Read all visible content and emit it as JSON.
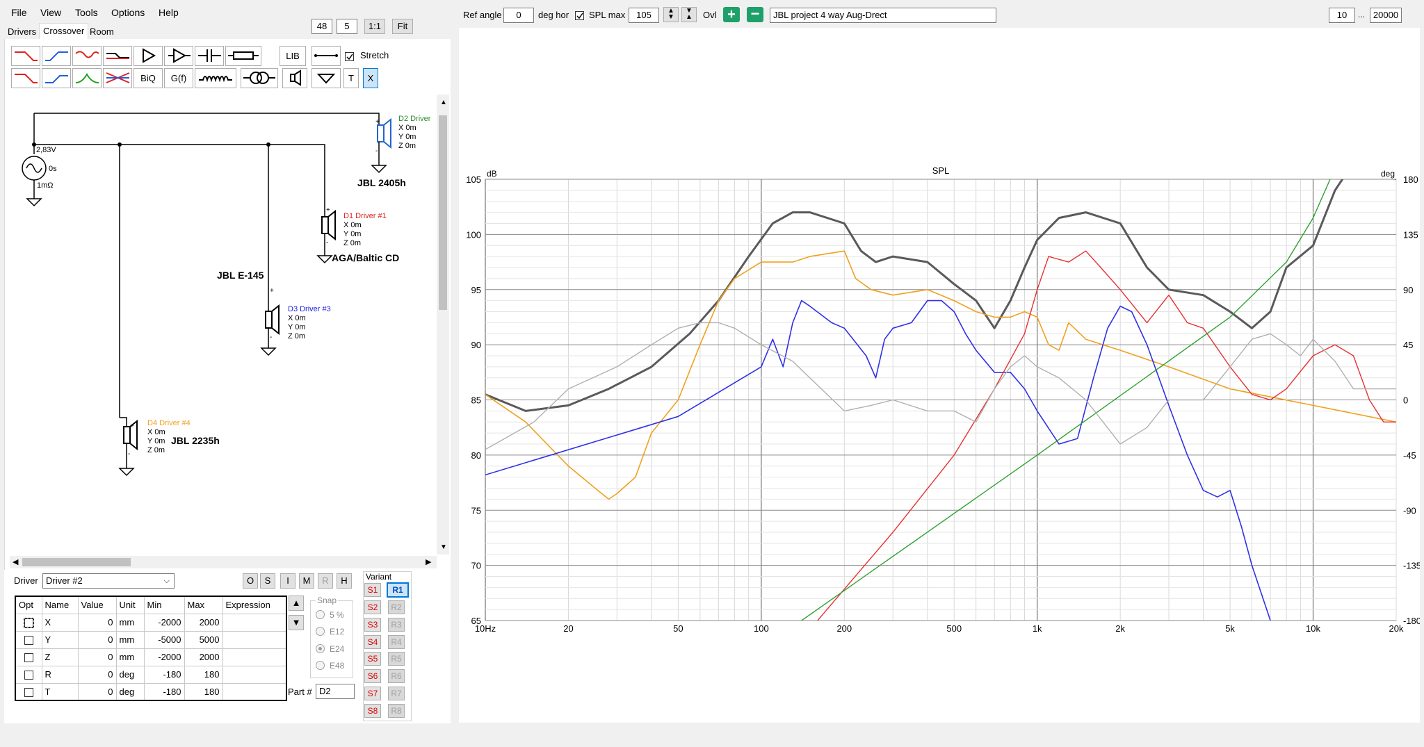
{
  "menu": [
    "File",
    "View",
    "Tools",
    "Options",
    "Help"
  ],
  "top_controls": {
    "value1": "48",
    "value2": "5",
    "ratio_button": "1:1",
    "fit_button": "Fit"
  },
  "tabs": [
    "Drivers",
    "Crossover",
    "Room"
  ],
  "toolbar": {
    "lib": "LIB",
    "biq": "BiQ",
    "gf": "G(f)",
    "t": "T",
    "x": "X",
    "stretch": "Stretch"
  },
  "schematic": {
    "source": {
      "voltage": "2,83V",
      "delay": "0s",
      "impedance": "1mΩ"
    },
    "drivers": [
      {
        "id": "D2",
        "label": "D2 Driver",
        "x": "X 0m",
        "y": "Y 0m",
        "z": "Z 0m",
        "name": "JBL 2405h",
        "color": "#2e8b2e"
      },
      {
        "id": "D1",
        "label": "D1 Driver #1",
        "x": "X 0m",
        "y": "Y 0m",
        "z": "Z 0m",
        "name": "AGA/Baltic CD",
        "color": "#e02020"
      },
      {
        "id": "D3",
        "label": "D3 Driver #3",
        "x": "X 0m",
        "y": "Y 0m",
        "z": "Z 0m",
        "name": "JBL E-145",
        "color": "#2020e0"
      },
      {
        "id": "D4",
        "label": "D4 Driver #4",
        "x": "X 0m",
        "y": "Y 0m",
        "z": "Z 0m",
        "name": "JBL 2235h",
        "color": "#f0a020"
      }
    ]
  },
  "driver_panel": {
    "label": "Driver",
    "selected": "Driver #2",
    "buttons": [
      "O",
      "S",
      "I",
      "M",
      "R",
      "H"
    ],
    "columns": [
      "Opt",
      "Name",
      "Value",
      "Unit",
      "Min",
      "Max",
      "Expression"
    ],
    "rows": [
      {
        "name": "X",
        "value": "0",
        "unit": "mm",
        "min": "-2000",
        "max": "2000",
        "expr": ""
      },
      {
        "name": "Y",
        "value": "0",
        "unit": "mm",
        "min": "-5000",
        "max": "5000",
        "expr": ""
      },
      {
        "name": "Z",
        "value": "0",
        "unit": "mm",
        "min": "-2000",
        "max": "2000",
        "expr": ""
      },
      {
        "name": "R",
        "value": "0",
        "unit": "deg",
        "min": "-180",
        "max": "180",
        "expr": ""
      },
      {
        "name": "T",
        "value": "0",
        "unit": "deg",
        "min": "-180",
        "max": "180",
        "expr": ""
      }
    ],
    "snap": {
      "label": "Snap",
      "options": [
        "5 %",
        "E12",
        "E24",
        "E48"
      ],
      "selected": "E24"
    },
    "part_label": "Part #",
    "part_value": "D2",
    "variant_label": "Variant",
    "variants_s": [
      "S1",
      "S2",
      "S3",
      "S4",
      "S5",
      "S6",
      "S7",
      "S8"
    ],
    "variants_r": [
      "R1",
      "R2",
      "R3",
      "R4",
      "R5",
      "R6",
      "R7",
      "R8"
    ]
  },
  "graph_controls": {
    "ref_angle_label": "Ref angle",
    "ref_angle": "0",
    "deg_hor": "deg hor",
    "spl_max_label": "SPL max",
    "spl_max": "105",
    "ovl": "Ovl",
    "title": "JBL project 4 way Aug-Drect",
    "fmin": "10",
    "dots": "...",
    "fmax": "20000"
  },
  "chart_data": {
    "type": "line",
    "title": "SPL",
    "ylabel": "dB",
    "y2label": "deg",
    "xscale": "log",
    "xlim": [
      10,
      20000
    ],
    "ylim": [
      65,
      105
    ],
    "y2lim": [
      -180,
      180
    ],
    "x_ticks": [
      "10Hz",
      "20",
      "50",
      "100",
      "200",
      "500",
      "1k",
      "2k",
      "5k",
      "10k",
      "20k"
    ],
    "y_ticks": [
      "105",
      "100",
      "95",
      "90",
      "85",
      "80",
      "75",
      "70",
      "65"
    ],
    "y2_ticks": [
      "180",
      "135",
      "90",
      "45",
      "0",
      "-45",
      "-90",
      "-135",
      "-180"
    ],
    "grid": true,
    "series": [
      {
        "color": "#5a5a5a",
        "width": 3,
        "x": [
          10,
          14,
          20,
          28,
          40,
          55,
          70,
          90,
          110,
          130,
          150,
          200,
          230,
          260,
          300,
          400,
          500,
          600,
          700,
          800,
          900,
          1000,
          1200,
          1500,
          2000,
          2500,
          3000,
          4000,
          5000,
          6000,
          7000,
          8000,
          10000,
          12000,
          14000,
          16000,
          20000
        ],
        "y": [
          85.5,
          84,
          84.5,
          86,
          88,
          91,
          94,
          98,
          101,
          102,
          102,
          101,
          98.5,
          97.5,
          98,
          97.5,
          95.5,
          94,
          91.5,
          94,
          97,
          99.5,
          101.5,
          102,
          101,
          97,
          95,
          94.5,
          93,
          91.5,
          93,
          97,
          99,
          104,
          106.5,
          106,
          105
        ]
      },
      {
        "color": "#f0a020",
        "width": 1.6,
        "x": [
          10,
          14,
          20,
          25,
          28,
          30,
          35,
          40,
          50,
          60,
          70,
          80,
          100,
          130,
          150,
          200,
          220,
          250,
          300,
          400,
          500,
          600,
          700,
          800,
          900,
          1000,
          1100,
          1200,
          1300,
          1500,
          2000,
          3000,
          5000,
          10000,
          20000
        ],
        "y": [
          85.5,
          83,
          79,
          77,
          76,
          76.5,
          78,
          82,
          85,
          90,
          94,
          96,
          97.5,
          97.5,
          98,
          98.5,
          96,
          95,
          94.5,
          95,
          94,
          93,
          92.5,
          92.5,
          93,
          92.5,
          90,
          89.5,
          92,
          90.5,
          89.5,
          88,
          86,
          84.5,
          83
        ]
      },
      {
        "color": "#3030e8",
        "width": 1.6,
        "x": [
          10,
          50,
          100,
          110,
          120,
          130,
          140,
          150,
          180,
          200,
          240,
          260,
          280,
          300,
          350,
          400,
          450,
          500,
          550,
          600,
          700,
          800,
          900,
          1000,
          1200,
          1400,
          1600,
          1800,
          2000,
          2200,
          2500,
          3000,
          3500,
          4000,
          4500,
          5000,
          5500,
          6000,
          7000
        ],
        "y": [
          78.2,
          83.5,
          88,
          90.5,
          88,
          92,
          94,
          93.5,
          92,
          91.5,
          89,
          87,
          90.5,
          91.5,
          92,
          94,
          94,
          93,
          91,
          89.5,
          87.5,
          87.5,
          86,
          84,
          81,
          81.5,
          87,
          91.5,
          93.5,
          93,
          90,
          84.5,
          80,
          76.8,
          76.2,
          76.8,
          73.5,
          70,
          65
        ]
      },
      {
        "color": "#e83030",
        "width": 1.4,
        "x": [
          160,
          300,
          500,
          700,
          900,
          1000,
          1100,
          1300,
          1500,
          1700,
          2000,
          2500,
          3000,
          3500,
          4000,
          5000,
          6000,
          7000,
          8000,
          10000,
          12000,
          14000,
          16000,
          18000,
          20000
        ],
        "y": [
          65,
          73,
          80,
          86,
          91,
          95,
          98,
          97.5,
          98.5,
          97,
          95,
          92,
          94.5,
          92,
          91.5,
          88,
          85.5,
          85,
          86,
          89,
          90,
          89,
          85,
          83,
          83
        ]
      },
      {
        "color": "#30a030",
        "width": 1.4,
        "x": [
          140,
          1000,
          5000,
          8000,
          10000,
          12000,
          14000,
          16000,
          20000
        ],
        "y": [
          65,
          80,
          92.5,
          97.5,
          101.5,
          106,
          106.5,
          105.5,
          105
        ]
      },
      {
        "color": "#b0b0b0",
        "width": 1.4,
        "x": [
          10,
          15,
          20,
          30,
          40,
          50,
          60,
          70,
          80,
          100,
          130,
          150,
          200,
          250,
          300,
          400,
          500,
          600,
          700,
          800,
          900,
          1000,
          1200,
          1500,
          2000,
          2500,
          3000,
          4000,
          5000,
          6000,
          7000,
          8000,
          9000,
          10000,
          12000,
          14000,
          20000
        ],
        "y": [
          80.5,
          83,
          86,
          88,
          90,
          91.5,
          92,
          92,
          91.5,
          90,
          88.5,
          87,
          84,
          84.5,
          85,
          84,
          84,
          83,
          86,
          88,
          89,
          88,
          87,
          85,
          81,
          82.5,
          85,
          85,
          88,
          90.5,
          91,
          90,
          89,
          90.5,
          88.5,
          86,
          86
        ]
      }
    ]
  }
}
